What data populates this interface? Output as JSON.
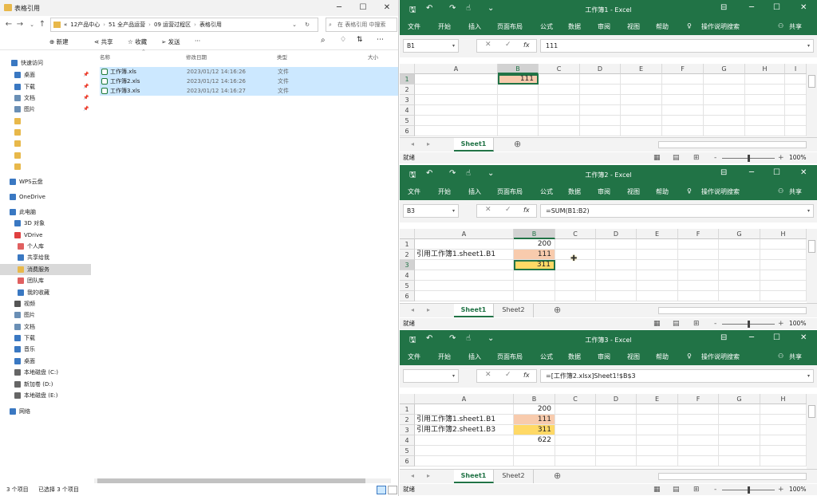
{
  "explorer": {
    "title": "表格引用",
    "path": [
      "«",
      "12产品中心",
      "51 全产品运营",
      "09 运营过程区",
      "表格引用"
    ],
    "search_placeholder": "在 表格引用 中搜索",
    "commands": {
      "new": "新建",
      "share": "共享",
      "favorite": "收藏",
      "send": "发送",
      "more": "···"
    },
    "nav": [
      {
        "label": "快速访问",
        "icon": "star-icon"
      },
      {
        "label": "桌面",
        "icon": "desktop-icon"
      },
      {
        "label": "下载",
        "icon": "download-icon"
      },
      {
        "label": "文档",
        "icon": "document-icon"
      },
      {
        "label": "图片",
        "icon": "picture-icon"
      },
      {
        "label": "",
        "icon": "folder-icon"
      },
      {
        "label": "",
        "icon": "folder-icon"
      },
      {
        "label": "",
        "icon": "folder-icon"
      },
      {
        "label": "",
        "icon": "folder-icon"
      },
      {
        "label": "",
        "icon": "folder-icon"
      },
      {
        "label": "WPS云盘",
        "icon": "cloud-icon"
      },
      {
        "label": "OneDrive",
        "icon": "cloud-icon"
      },
      {
        "label": "此电脑",
        "icon": "computer-icon"
      },
      {
        "label": "3D 对象",
        "icon": "cube-icon"
      },
      {
        "label": "VDrive",
        "icon": "drive-icon"
      },
      {
        "label": "个人库",
        "icon": "person-icon"
      },
      {
        "label": "共享给我",
        "icon": "share-icon"
      },
      {
        "label": "消费服务",
        "icon": "folder-icon"
      },
      {
        "label": "团队库",
        "icon": "team-icon"
      },
      {
        "label": "我的收藏",
        "icon": "star-icon"
      },
      {
        "label": "视频",
        "icon": "video-icon"
      },
      {
        "label": "图片",
        "icon": "picture-icon"
      },
      {
        "label": "文档",
        "icon": "document-icon"
      },
      {
        "label": "下载",
        "icon": "download-icon"
      },
      {
        "label": "音乐",
        "icon": "music-icon"
      },
      {
        "label": "桌面",
        "icon": "desktop-icon"
      },
      {
        "label": "本地磁盘 (C:)",
        "icon": "disk-icon"
      },
      {
        "label": "新加卷 (D:)",
        "icon": "disk-icon"
      },
      {
        "label": "本地磁盘 (E:)",
        "icon": "disk-icon"
      },
      {
        "label": "网络",
        "icon": "network-icon"
      }
    ],
    "columns": {
      "name": "名称",
      "date": "修改日期",
      "type": "类型",
      "size": "大小"
    },
    "files": [
      {
        "name": "工作簿.xls",
        "date": "2023/01/12 14:16:26",
        "type": "文件"
      },
      {
        "name": "工作簿2.xls",
        "date": "2023/01/12 14:16:26",
        "type": "文件"
      },
      {
        "name": "工作簿3.xls",
        "date": "2023/01/12 14:16:27",
        "type": "文件"
      }
    ],
    "status": {
      "count": "3 个项目",
      "selected": "已选择 3 个项目"
    }
  },
  "ribbon_tabs": [
    "文件",
    "开始",
    "插入",
    "页面布局",
    "公式",
    "数据",
    "审阅",
    "视图",
    "帮助"
  ],
  "tell_me": "操作说明搜索",
  "share": "共享",
  "status_ready": "就绪",
  "zoom": "100%",
  "workbooks": [
    {
      "title": "工作簿1 - Excel",
      "namebox": "B1",
      "formula": "111",
      "cols": [
        "A",
        "B",
        "C",
        "D",
        "E",
        "F",
        "G",
        "H",
        "I"
      ],
      "rows": [
        "1",
        "2",
        "3",
        "4",
        "5",
        "6"
      ],
      "cells": [
        {
          "ref": "B1",
          "value": "111",
          "type": "num",
          "fill": "peach"
        }
      ],
      "tabs": [
        "Sheet1"
      ]
    },
    {
      "title": "工作簿2 - Excel",
      "namebox": "B3",
      "formula": "=SUM(B1:B2)",
      "cols": [
        "A",
        "B",
        "C",
        "D",
        "E",
        "F",
        "G",
        "H"
      ],
      "rows": [
        "1",
        "2",
        "3",
        "4",
        "5",
        "6"
      ],
      "cells": [
        {
          "ref": "B1",
          "value": "200",
          "type": "num"
        },
        {
          "ref": "A2",
          "value": "引用工作簿1.sheet1.B1",
          "type": "txt"
        },
        {
          "ref": "B2",
          "value": "111",
          "type": "num",
          "fill": "peach"
        },
        {
          "ref": "B3",
          "value": "311",
          "type": "num",
          "fill": "gold"
        }
      ],
      "tabs": [
        "Sheet1",
        "Sheet2"
      ]
    },
    {
      "title": "工作簿3 - Excel",
      "namebox": "",
      "formula": "=[工作簿2.xlsx]Sheet1!$B$3",
      "cols": [
        "A",
        "B",
        "C",
        "D",
        "E",
        "F",
        "G",
        "H"
      ],
      "rows": [
        "1",
        "2",
        "3",
        "4",
        "5",
        "6"
      ],
      "cells": [
        {
          "ref": "B1",
          "value": "200",
          "type": "num"
        },
        {
          "ref": "A2",
          "value": "引用工作簿1.sheet1.B1",
          "type": "txt"
        },
        {
          "ref": "B2",
          "value": "111",
          "type": "num",
          "fill": "peach"
        },
        {
          "ref": "A3",
          "value": "引用工作簿2.sheet1.B3",
          "type": "txt"
        },
        {
          "ref": "B3",
          "value": "311",
          "type": "num",
          "fill": "gold"
        },
        {
          "ref": "B4",
          "value": "622",
          "type": "num"
        }
      ],
      "tabs": [
        "Sheet1",
        "Sheet2"
      ]
    }
  ]
}
